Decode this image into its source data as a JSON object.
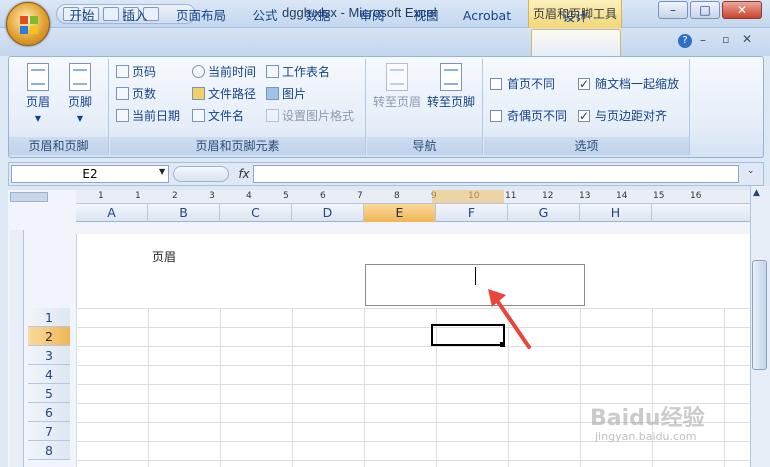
{
  "window": {
    "title": "dggh.xlsx - Microsoft Excel",
    "context_tab": "页眉和页脚工具"
  },
  "window_controls": {
    "minimize": "–",
    "restore": "□",
    "close": "✕"
  },
  "tabs": [
    "开始",
    "插入",
    "页面布局",
    "公式",
    "数据",
    "审阅",
    "视图",
    "Acrobat",
    "设计"
  ],
  "ribbon": {
    "group1": {
      "label": "页眉和页脚",
      "header": "页眉",
      "footer": "页脚"
    },
    "group2": {
      "label": "页眉和页脚元素",
      "items": [
        "页码",
        "页数",
        "当前日期",
        "当前时间",
        "文件路径",
        "文件名",
        "工作表名",
        "图片",
        "设置图片格式"
      ]
    },
    "group3": {
      "label": "导航",
      "goto_header": "转至页眉",
      "goto_footer": "转至页脚"
    },
    "group4": {
      "label": "选项",
      "checks": [
        {
          "label": "首页不同",
          "checked": false
        },
        {
          "label": "奇偶页不同",
          "checked": false
        },
        {
          "label": "随文档一起缩放",
          "checked": true
        },
        {
          "label": "与页边距对齐",
          "checked": true
        }
      ]
    }
  },
  "formula_bar": {
    "name_box": "E2",
    "fx": "fx"
  },
  "columns": [
    "A",
    "B",
    "C",
    "D",
    "E",
    "F",
    "G",
    "H"
  ],
  "selected_column": "E",
  "rows": [
    "1",
    "2",
    "3",
    "4",
    "5",
    "6",
    "7",
    "8"
  ],
  "selected_row": "2",
  "ruler_numbers": [
    "1",
    "1",
    "2",
    "3",
    "4",
    "5",
    "6",
    "7",
    "8",
    "9",
    "10",
    "11",
    "12",
    "13",
    "14",
    "15",
    "16"
  ],
  "page": {
    "header_label": "页眉"
  },
  "watermark": {
    "brand": "Baidu经验",
    "url": "jingyan.baidu.com"
  }
}
